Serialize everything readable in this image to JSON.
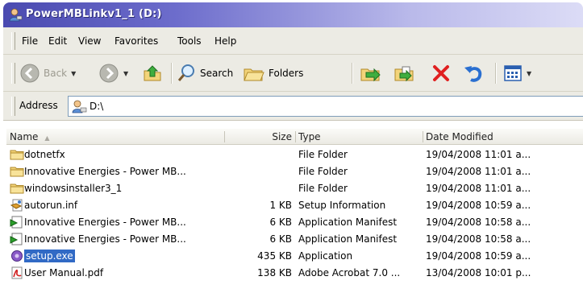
{
  "window": {
    "title": "PowerMBLinkv1_1 (D:)"
  },
  "menu": [
    "File",
    "Edit",
    "View",
    "Favorites",
    "Tools",
    "Help"
  ],
  "toolbar": {
    "back_label": "Back",
    "search_label": "Search",
    "folders_label": "Folders"
  },
  "address": {
    "label": "Address",
    "value": "D:\\"
  },
  "columns": {
    "name": "Name",
    "size": "Size",
    "type": "Type",
    "date": "Date Modified"
  },
  "files": [
    {
      "name": "dotnetfx",
      "size": "",
      "type": "File Folder",
      "date": "19/04/2008 11:01 a...",
      "icon": "folder-icon"
    },
    {
      "name": "Innovative Energies - Power MB...",
      "size": "",
      "type": "File Folder",
      "date": "19/04/2008 11:01 a...",
      "icon": "folder-icon"
    },
    {
      "name": "windowsinstaller3_1",
      "size": "",
      "type": "File Folder",
      "date": "19/04/2008 11:01 a...",
      "icon": "folder-icon"
    },
    {
      "name": "autorun.inf",
      "size": "1 KB",
      "type": "Setup Information",
      "date": "19/04/2008 10:59 a...",
      "icon": "setup-information-icon"
    },
    {
      "name": "Innovative Energies - Power MB...",
      "size": "6 KB",
      "type": "Application Manifest",
      "date": "19/04/2008 10:58 a...",
      "icon": "manifest-icon"
    },
    {
      "name": "Innovative Energies - Power MB...",
      "size": "6 KB",
      "type": "Application Manifest",
      "date": "19/04/2008 10:58 a...",
      "icon": "manifest-icon"
    },
    {
      "name": "setup.exe",
      "size": "435 KB",
      "type": "Application",
      "date": "19/04/2008 10:59 a...",
      "icon": "application-icon",
      "selected": true
    },
    {
      "name": "User Manual.pdf",
      "size": "138 KB",
      "type": "Adobe Acrobat 7.0 ...",
      "date": "13/04/2008 10:01 p...",
      "icon": "pdf-icon"
    }
  ],
  "colors": {
    "title_bar": "#4a4ab0",
    "selection": "#316ac5",
    "toolbar_bg": "#ecebe4"
  }
}
